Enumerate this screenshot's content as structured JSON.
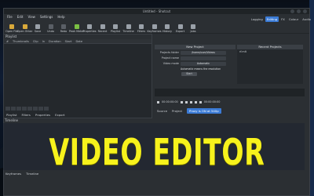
{
  "window": {
    "title": "Untitled - Shotcut"
  },
  "menu": [
    "File",
    "Edit",
    "View",
    "Settings",
    "Help"
  ],
  "toolbar": [
    {
      "label": "Open File",
      "icon": "folder-icon",
      "color": "#d9a93a"
    },
    {
      "label": "Open Other",
      "icon": "open-other-icon",
      "color": "#d9a93a"
    },
    {
      "label": "Save",
      "icon": "save-icon",
      "color": "#9aa1a9"
    },
    {
      "label": "Undo",
      "icon": "undo-icon",
      "color": "#5a5f66"
    },
    {
      "label": "Redo",
      "icon": "redo-icon",
      "color": "#5a5f66"
    },
    {
      "label": "Peak Meter",
      "icon": "meter-icon",
      "color": "#7bc043"
    },
    {
      "label": "Properties",
      "icon": "properties-icon",
      "color": "#9aa1a9"
    },
    {
      "label": "Recent",
      "icon": "recent-icon",
      "color": "#9aa1a9"
    },
    {
      "label": "Playlist",
      "icon": "playlist-icon",
      "color": "#9aa1a9"
    },
    {
      "label": "Timeline",
      "icon": "timeline-icon",
      "color": "#9aa1a9"
    },
    {
      "label": "Filters",
      "icon": "filters-icon",
      "color": "#9aa1a9"
    },
    {
      "label": "Keyframes",
      "icon": "keyframes-icon",
      "color": "#9aa1a9"
    },
    {
      "label": "History",
      "icon": "history-icon",
      "color": "#9aa1a9"
    },
    {
      "label": "Export",
      "icon": "export-icon",
      "color": "#9aa1a9"
    },
    {
      "label": "Jobs",
      "icon": "jobs-icon",
      "color": "#9aa1a9"
    }
  ],
  "layouts": [
    "Logging",
    "Editing",
    "FX",
    "Colour",
    "Audio"
  ],
  "playlist": {
    "header": "Playlist",
    "columns": [
      "#",
      "Thumbnails",
      "Clip",
      "In",
      "Duration",
      "Start",
      "Date"
    ],
    "tabs": [
      "Playlist",
      "Filters",
      "Properties",
      "Export"
    ]
  },
  "new_project": {
    "header": "New Project",
    "folder_label": "Projects folder",
    "folder_value": "/home/user/Videos",
    "name_label": "Project name",
    "name_value": "",
    "mode_label": "Video mode",
    "mode_value": "Automatic",
    "auto_note": "Automatic means the resolution",
    "start_label": "Start"
  },
  "recent": {
    "header": "Recent Projects",
    "items": [
      "rf.mlt"
    ]
  },
  "transport": {
    "timecode": "00:00:00:00",
    "timecode2": "00:00:00:00"
  },
  "source_tabs": [
    "Source",
    "Project"
  ],
  "proxy": "Proxy is ON at 540p",
  "timeline_header": "Timeline",
  "bottom_tabs": [
    "Keyframes",
    "Timeline"
  ],
  "overlay_title": "VIDEO EDITOR",
  "colors": {
    "accent": "#3b7bd6",
    "title_yellow": "#f7f21c"
  }
}
